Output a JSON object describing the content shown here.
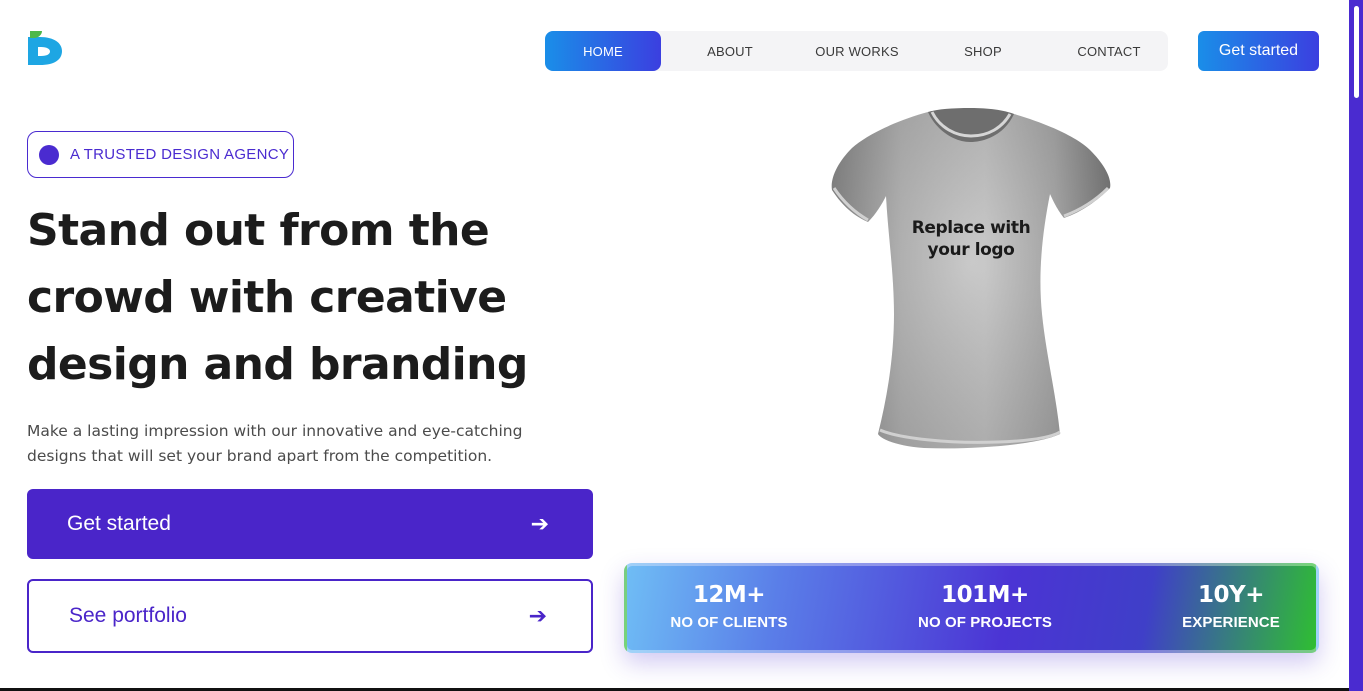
{
  "brand": {
    "logo_icon": "d-letter-logo-icon"
  },
  "nav": {
    "items": [
      {
        "label": "HOME",
        "active": true
      },
      {
        "label": "ABOUT",
        "active": false
      },
      {
        "label": "OUR WORKS",
        "active": false
      },
      {
        "label": "SHOP",
        "active": false
      },
      {
        "label": "CONTACT",
        "active": false
      }
    ],
    "cta_label": "Get started"
  },
  "hero": {
    "badge": "A TRUSTED DESIGN AGENCY",
    "headline_lines": [
      "Stand out from the",
      "crowd with creative",
      "design and branding"
    ],
    "subtext_lines": [
      "Make a lasting impression with our innovative and eye-catching",
      "designs that will set your brand apart from the competition."
    ],
    "primary_button": "Get started",
    "secondary_button": "See portfolio",
    "arrow_icon": "arrow-right-icon"
  },
  "mockup": {
    "text_lines": [
      "Replace with",
      "your logo"
    ]
  },
  "stats": [
    {
      "value": "12M+",
      "label": "NO OF CLIENTS"
    },
    {
      "value": "101M+",
      "label": "NO OF PROJECTS"
    },
    {
      "value": "10Y+",
      "label": "EXPERIENCE"
    }
  ],
  "colors": {
    "accent": "#4a25c9",
    "nav_gradient_start": "#1a8ee8",
    "nav_gradient_end": "#3b3fe0",
    "stats_green": "#2fbe32"
  }
}
